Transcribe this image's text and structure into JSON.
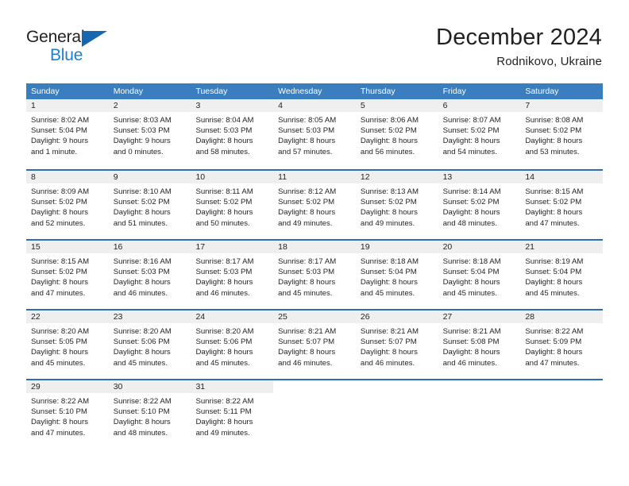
{
  "brand": {
    "name_part1": "General",
    "name_part2": "Blue",
    "triangle_icon": "triangle-icon"
  },
  "header": {
    "month_title": "December 2024",
    "location": "Rodnikovo, Ukraine"
  },
  "colors": {
    "header_blue": "#3a7ec0",
    "row_divider_blue": "#2f6faf",
    "day_band_gray": "#efefef",
    "brand_blue": "#1b7fd4",
    "brand_triangle": "#1666b0",
    "text": "#231f20"
  },
  "weekdays": [
    "Sunday",
    "Monday",
    "Tuesday",
    "Wednesday",
    "Thursday",
    "Friday",
    "Saturday"
  ],
  "weeks": [
    [
      {
        "day": "1",
        "sunrise": "Sunrise: 8:02 AM",
        "sunset": "Sunset: 5:04 PM",
        "daylight_line1": "Daylight: 9 hours",
        "daylight_line2": "and 1 minute."
      },
      {
        "day": "2",
        "sunrise": "Sunrise: 8:03 AM",
        "sunset": "Sunset: 5:03 PM",
        "daylight_line1": "Daylight: 9 hours",
        "daylight_line2": "and 0 minutes."
      },
      {
        "day": "3",
        "sunrise": "Sunrise: 8:04 AM",
        "sunset": "Sunset: 5:03 PM",
        "daylight_line1": "Daylight: 8 hours",
        "daylight_line2": "and 58 minutes."
      },
      {
        "day": "4",
        "sunrise": "Sunrise: 8:05 AM",
        "sunset": "Sunset: 5:03 PM",
        "daylight_line1": "Daylight: 8 hours",
        "daylight_line2": "and 57 minutes."
      },
      {
        "day": "5",
        "sunrise": "Sunrise: 8:06 AM",
        "sunset": "Sunset: 5:02 PM",
        "daylight_line1": "Daylight: 8 hours",
        "daylight_line2": "and 56 minutes."
      },
      {
        "day": "6",
        "sunrise": "Sunrise: 8:07 AM",
        "sunset": "Sunset: 5:02 PM",
        "daylight_line1": "Daylight: 8 hours",
        "daylight_line2": "and 54 minutes."
      },
      {
        "day": "7",
        "sunrise": "Sunrise: 8:08 AM",
        "sunset": "Sunset: 5:02 PM",
        "daylight_line1": "Daylight: 8 hours",
        "daylight_line2": "and 53 minutes."
      }
    ],
    [
      {
        "day": "8",
        "sunrise": "Sunrise: 8:09 AM",
        "sunset": "Sunset: 5:02 PM",
        "daylight_line1": "Daylight: 8 hours",
        "daylight_line2": "and 52 minutes."
      },
      {
        "day": "9",
        "sunrise": "Sunrise: 8:10 AM",
        "sunset": "Sunset: 5:02 PM",
        "daylight_line1": "Daylight: 8 hours",
        "daylight_line2": "and 51 minutes."
      },
      {
        "day": "10",
        "sunrise": "Sunrise: 8:11 AM",
        "sunset": "Sunset: 5:02 PM",
        "daylight_line1": "Daylight: 8 hours",
        "daylight_line2": "and 50 minutes."
      },
      {
        "day": "11",
        "sunrise": "Sunrise: 8:12 AM",
        "sunset": "Sunset: 5:02 PM",
        "daylight_line1": "Daylight: 8 hours",
        "daylight_line2": "and 49 minutes."
      },
      {
        "day": "12",
        "sunrise": "Sunrise: 8:13 AM",
        "sunset": "Sunset: 5:02 PM",
        "daylight_line1": "Daylight: 8 hours",
        "daylight_line2": "and 49 minutes."
      },
      {
        "day": "13",
        "sunrise": "Sunrise: 8:14 AM",
        "sunset": "Sunset: 5:02 PM",
        "daylight_line1": "Daylight: 8 hours",
        "daylight_line2": "and 48 minutes."
      },
      {
        "day": "14",
        "sunrise": "Sunrise: 8:15 AM",
        "sunset": "Sunset: 5:02 PM",
        "daylight_line1": "Daylight: 8 hours",
        "daylight_line2": "and 47 minutes."
      }
    ],
    [
      {
        "day": "15",
        "sunrise": "Sunrise: 8:15 AM",
        "sunset": "Sunset: 5:02 PM",
        "daylight_line1": "Daylight: 8 hours",
        "daylight_line2": "and 47 minutes."
      },
      {
        "day": "16",
        "sunrise": "Sunrise: 8:16 AM",
        "sunset": "Sunset: 5:03 PM",
        "daylight_line1": "Daylight: 8 hours",
        "daylight_line2": "and 46 minutes."
      },
      {
        "day": "17",
        "sunrise": "Sunrise: 8:17 AM",
        "sunset": "Sunset: 5:03 PM",
        "daylight_line1": "Daylight: 8 hours",
        "daylight_line2": "and 46 minutes."
      },
      {
        "day": "18",
        "sunrise": "Sunrise: 8:17 AM",
        "sunset": "Sunset: 5:03 PM",
        "daylight_line1": "Daylight: 8 hours",
        "daylight_line2": "and 45 minutes."
      },
      {
        "day": "19",
        "sunrise": "Sunrise: 8:18 AM",
        "sunset": "Sunset: 5:04 PM",
        "daylight_line1": "Daylight: 8 hours",
        "daylight_line2": "and 45 minutes."
      },
      {
        "day": "20",
        "sunrise": "Sunrise: 8:18 AM",
        "sunset": "Sunset: 5:04 PM",
        "daylight_line1": "Daylight: 8 hours",
        "daylight_line2": "and 45 minutes."
      },
      {
        "day": "21",
        "sunrise": "Sunrise: 8:19 AM",
        "sunset": "Sunset: 5:04 PM",
        "daylight_line1": "Daylight: 8 hours",
        "daylight_line2": "and 45 minutes."
      }
    ],
    [
      {
        "day": "22",
        "sunrise": "Sunrise: 8:20 AM",
        "sunset": "Sunset: 5:05 PM",
        "daylight_line1": "Daylight: 8 hours",
        "daylight_line2": "and 45 minutes."
      },
      {
        "day": "23",
        "sunrise": "Sunrise: 8:20 AM",
        "sunset": "Sunset: 5:06 PM",
        "daylight_line1": "Daylight: 8 hours",
        "daylight_line2": "and 45 minutes."
      },
      {
        "day": "24",
        "sunrise": "Sunrise: 8:20 AM",
        "sunset": "Sunset: 5:06 PM",
        "daylight_line1": "Daylight: 8 hours",
        "daylight_line2": "and 45 minutes."
      },
      {
        "day": "25",
        "sunrise": "Sunrise: 8:21 AM",
        "sunset": "Sunset: 5:07 PM",
        "daylight_line1": "Daylight: 8 hours",
        "daylight_line2": "and 46 minutes."
      },
      {
        "day": "26",
        "sunrise": "Sunrise: 8:21 AM",
        "sunset": "Sunset: 5:07 PM",
        "daylight_line1": "Daylight: 8 hours",
        "daylight_line2": "and 46 minutes."
      },
      {
        "day": "27",
        "sunrise": "Sunrise: 8:21 AM",
        "sunset": "Sunset: 5:08 PM",
        "daylight_line1": "Daylight: 8 hours",
        "daylight_line2": "and 46 minutes."
      },
      {
        "day": "28",
        "sunrise": "Sunrise: 8:22 AM",
        "sunset": "Sunset: 5:09 PM",
        "daylight_line1": "Daylight: 8 hours",
        "daylight_line2": "and 47 minutes."
      }
    ],
    [
      {
        "day": "29",
        "sunrise": "Sunrise: 8:22 AM",
        "sunset": "Sunset: 5:10 PM",
        "daylight_line1": "Daylight: 8 hours",
        "daylight_line2": "and 47 minutes."
      },
      {
        "day": "30",
        "sunrise": "Sunrise: 8:22 AM",
        "sunset": "Sunset: 5:10 PM",
        "daylight_line1": "Daylight: 8 hours",
        "daylight_line2": "and 48 minutes."
      },
      {
        "day": "31",
        "sunrise": "Sunrise: 8:22 AM",
        "sunset": "Sunset: 5:11 PM",
        "daylight_line1": "Daylight: 8 hours",
        "daylight_line2": "and 49 minutes."
      },
      {
        "day": "",
        "sunrise": "",
        "sunset": "",
        "daylight_line1": "",
        "daylight_line2": ""
      },
      {
        "day": "",
        "sunrise": "",
        "sunset": "",
        "daylight_line1": "",
        "daylight_line2": ""
      },
      {
        "day": "",
        "sunrise": "",
        "sunset": "",
        "daylight_line1": "",
        "daylight_line2": ""
      },
      {
        "day": "",
        "sunrise": "",
        "sunset": "",
        "daylight_line1": "",
        "daylight_line2": ""
      }
    ]
  ]
}
